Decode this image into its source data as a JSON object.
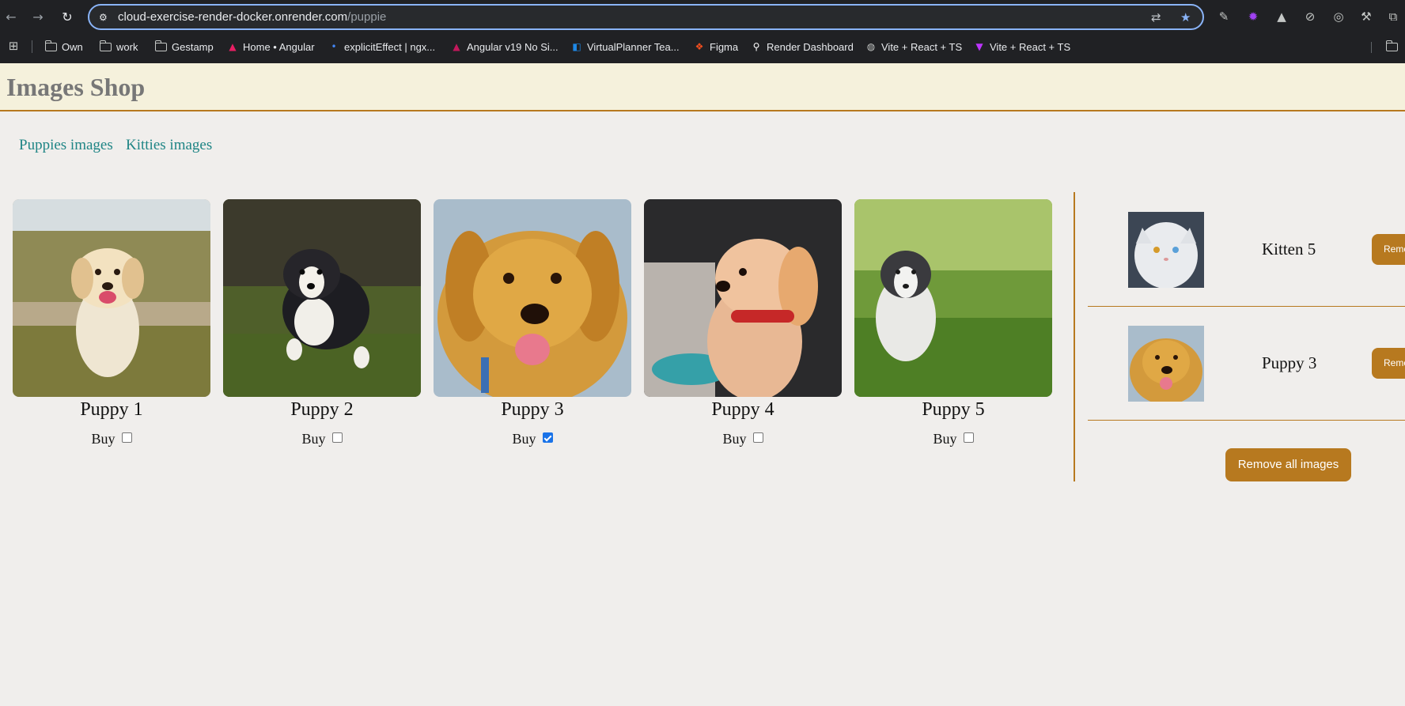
{
  "browser": {
    "url_host": "cloud-exercise-render-docker.onrender.com",
    "url_path": "/puppie",
    "bookmarks": [
      {
        "label": "Own",
        "icon": "folder-icon"
      },
      {
        "label": "work",
        "icon": "folder-icon"
      },
      {
        "label": "Gestamp",
        "icon": "folder-icon"
      },
      {
        "label": "Home • Angular",
        "icon": "angular-icon"
      },
      {
        "label": "explicitEffect | ngx...",
        "icon": "ngx-icon"
      },
      {
        "label": "Angular v19 No Si...",
        "icon": "angular-icon"
      },
      {
        "label": "VirtualPlanner Tea...",
        "icon": "azure-devops-icon"
      },
      {
        "label": "Figma",
        "icon": "figma-icon"
      },
      {
        "label": "Render Dashboard",
        "icon": "render-icon"
      },
      {
        "label": "Vite + React + TS",
        "icon": "globe-icon"
      },
      {
        "label": "Vite + React + TS",
        "icon": "vite-icon"
      }
    ]
  },
  "header": {
    "title": "Images Shop"
  },
  "nav": {
    "puppies": "Puppies images",
    "kitties": "Kitties images"
  },
  "gallery": [
    {
      "name": "Puppy 1",
      "buy_label": "Buy",
      "checked": false
    },
    {
      "name": "Puppy 2",
      "buy_label": "Buy",
      "checked": false
    },
    {
      "name": "Puppy 3",
      "buy_label": "Buy",
      "checked": true
    },
    {
      "name": "Puppy 4",
      "buy_label": "Buy",
      "checked": false
    },
    {
      "name": "Puppy 5",
      "buy_label": "Buy",
      "checked": false
    }
  ],
  "cart": {
    "items": [
      {
        "name": "Kitten 5",
        "remove_label": "Remove"
      },
      {
        "name": "Puppy 3",
        "remove_label": "Remove"
      }
    ],
    "remove_all_label": "Remove all images"
  },
  "colors": {
    "accent": "#b7791f",
    "link": "#1f8585",
    "header_bg": "#f5f1dc",
    "page_bg": "#f0eeec"
  }
}
